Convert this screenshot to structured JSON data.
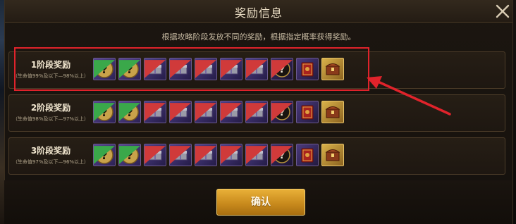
{
  "dialog": {
    "title": "奖励信息",
    "subtitle": "根据攻略阶段发放不同的奖励，根据指定概率获得奖励。",
    "confirm_label": "确认"
  },
  "stages": [
    {
      "name": "1阶段奖励",
      "range": "（生命值99%及以下—98%以上）"
    },
    {
      "name": "2阶段奖励",
      "range": "（生命值98%及以下—97%以上）"
    },
    {
      "name": "3阶段奖励",
      "range": "（生命值97%及以下—96%以上）"
    }
  ],
  "reward_icons": [
    "mystery-item-icon",
    "mystery-item-icon",
    "purple-box-icon",
    "purple-box-icon",
    "purple-box-icon",
    "purple-box-icon",
    "purple-box-icon",
    "dark-mystery-item-icon",
    "red-book-icon",
    "gold-chest-icon"
  ],
  "colors": {
    "accent_gold": "#e9b038",
    "highlight_red": "#e0232b",
    "panel_bg": "#1c1610"
  }
}
